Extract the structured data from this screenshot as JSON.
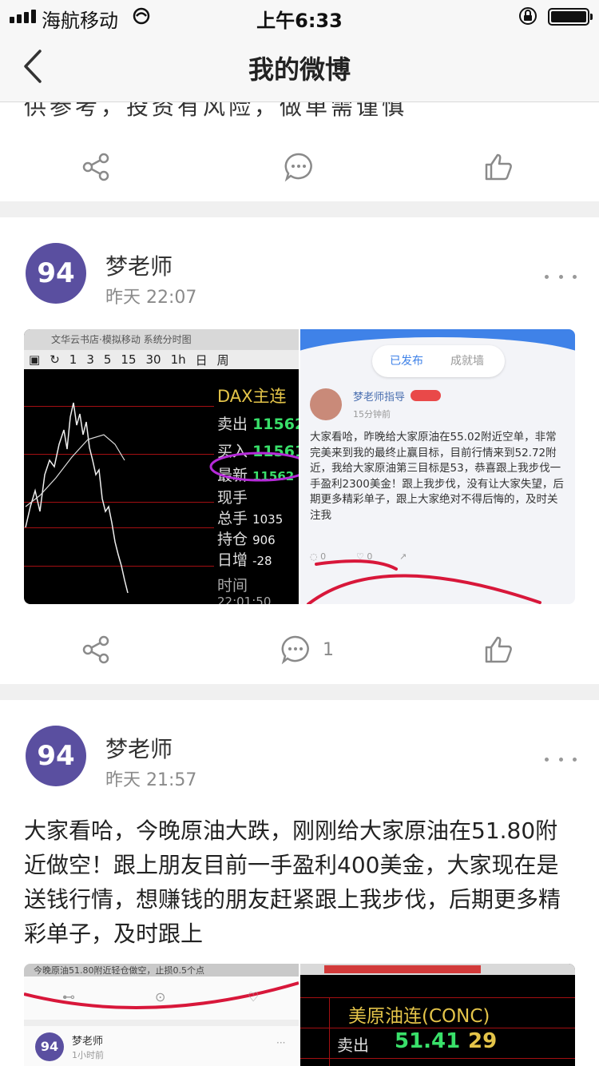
{
  "status_bar": {
    "carrier": "海航移动",
    "time": "上午6:33"
  },
  "nav": {
    "title": "我的微博"
  },
  "post0": {
    "text_tail": "供参考，投资有风险，做单需谨慎",
    "comment_count": "",
    "like_count": ""
  },
  "post1": {
    "avatar_text": "94",
    "author": "梦老师",
    "time": "昨天 22:07",
    "comment_count": "1",
    "image_left": {
      "top_strip": "文华云书店·模拟移动      系统分时图",
      "toolbar": [
        "1",
        "3",
        "5",
        "15",
        "30",
        "1h",
        "日",
        "周"
      ],
      "quote_title": "DAX主连",
      "rows": [
        {
          "label": "卖出",
          "value": "11562"
        },
        {
          "label": "买入",
          "value": "11561"
        },
        {
          "label": "最新",
          "value": "11562"
        },
        {
          "label": "现手",
          "value": ""
        },
        {
          "label": "总手",
          "value": "1035"
        },
        {
          "label": "持仓",
          "value": "906"
        },
        {
          "label": "日增",
          "value": "-28"
        },
        {
          "label": "时间",
          "value": ""
        },
        {
          "label": "22:01:50",
          "value": ""
        }
      ]
    },
    "image_right": {
      "tab_active": "已发布",
      "tab_inactive": "成就墙",
      "name": "梦老师指导",
      "time": "15分钟前",
      "text": "大家看哈，昨晚给大家原油在55.02附近空单，非常完美来到我的最终止赢目标，目前行情来到52.72附近，我给大家原油第三目标是53，恭喜跟上我步伐一手盈利2300美金！跟上我步伐，没有让大家失望，后期更多精彩单子，跟上大家绝对不得后悔的，及时关注我",
      "comment_count": "0",
      "like_count": "0"
    }
  },
  "post2": {
    "avatar_text": "94",
    "author": "梦老师",
    "time": "昨天 21:57",
    "text": "大家看哈，今晚原油大跌，刚刚给大家原油在51.80附近做空！跟上朋友目前一手盈利400美金，大家现在是送钱行情，想赚钱的朋友赶紧跟上我步伐，后期更多精彩单子，及时跟上",
    "image_left": {
      "top_text": "今晚原油51.80附近轻仓做空，止损0.5个点",
      "avatar_text": "94",
      "name": "梦老师",
      "time": "1小时前"
    },
    "image_right": {
      "title": "美原油连(CONC)",
      "row_label": "卖出",
      "row_value": "51.41",
      "row_qty": "29"
    }
  },
  "colors": {
    "avatar": "#5a4fa0",
    "divider": "#f0f0f0",
    "icon": "#8a8a8a",
    "quote_green": "#39e06a",
    "quote_gold": "#e4c449",
    "annotation_red": "#d8173a"
  }
}
